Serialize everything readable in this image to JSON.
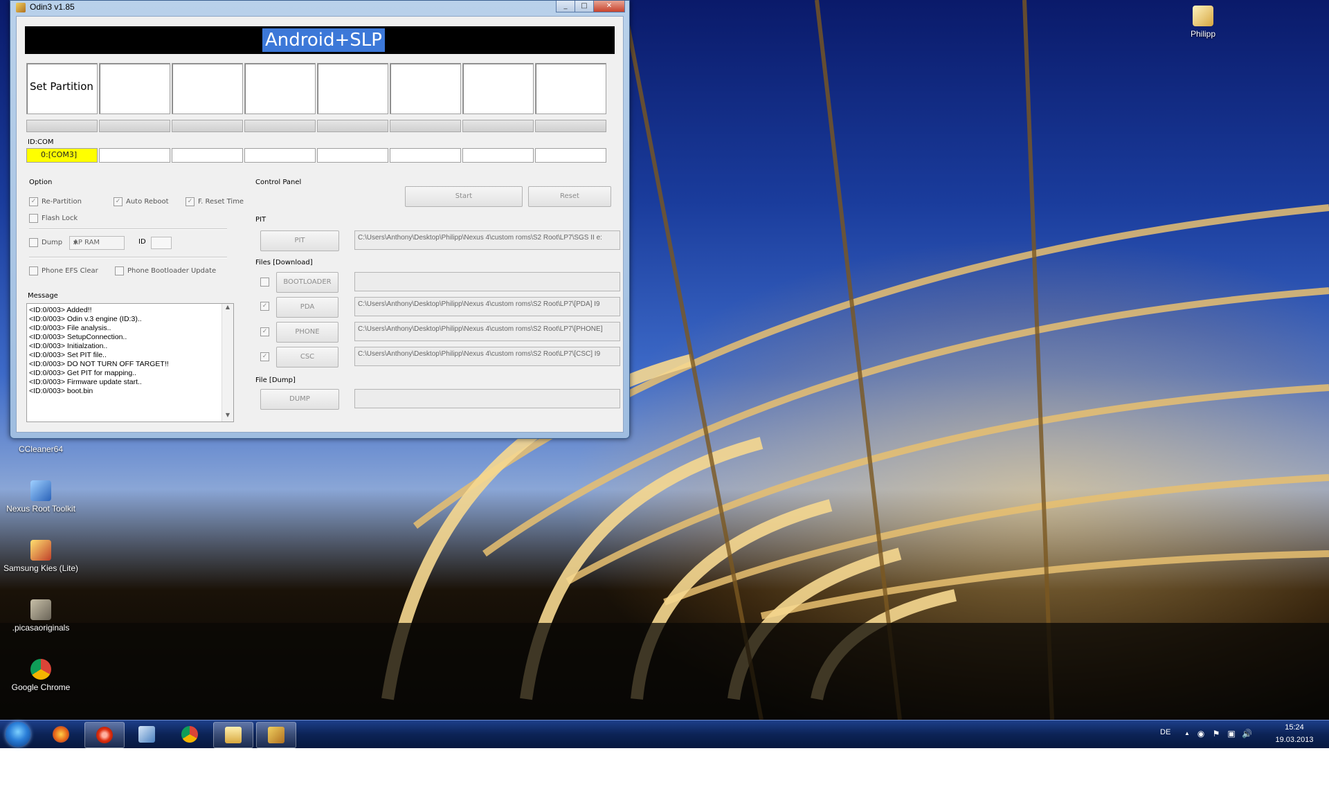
{
  "window": {
    "title": "Odin3 v1.85",
    "minimize_label": "_",
    "maximize_label": "□",
    "close_label": "✕"
  },
  "banner": {
    "text": "Android+SLP"
  },
  "ports": {
    "boxes": [
      "Set Partition",
      "",
      "",
      "",
      "",
      "",
      "",
      ""
    ],
    "idcom_label": "ID:COM",
    "com": [
      "0:[COM3]",
      "",
      "",
      "",
      "",
      "",
      "",
      ""
    ]
  },
  "option": {
    "label": "Option",
    "re_partition": "Re-Partition",
    "auto_reboot": "Auto Reboot",
    "f_reset_time": "F. Reset Time",
    "flash_lock": "Flash Lock",
    "dump": "Dump",
    "dump_select": "AP RAM",
    "id_label": "ID",
    "phone_efs_clear": "Phone EFS Clear",
    "phone_bootloader_update": "Phone Bootloader Update",
    "checked_mark": "✓"
  },
  "message": {
    "label": "Message",
    "lines": [
      "<ID:0/003> Added!!",
      "<ID:0/003> Odin v.3 engine (ID:3)..",
      "<ID:0/003> File analysis..",
      "<ID:0/003> SetupConnection..",
      "<ID:0/003> Initialzation..",
      "<ID:0/003> Set PIT file..",
      "<ID:0/003> DO NOT TURN OFF TARGET!!",
      "<ID:0/003> Get PIT for mapping..",
      "<ID:0/003> Firmware update start..",
      "<ID:0/003> boot.bin"
    ]
  },
  "control_panel": {
    "label": "Control Panel",
    "start": "Start",
    "reset": "Reset"
  },
  "pit": {
    "label": "PIT",
    "button": "PIT",
    "path": "C:\\Users\\Anthony\\Desktop\\Philipp\\Nexus 4\\custom roms\\S2 Root\\LP7\\SGS II e:"
  },
  "files": {
    "label": "Files [Download]",
    "bootloader": {
      "button": "BOOTLOADER",
      "path": ""
    },
    "pda": {
      "button": "PDA",
      "path": "C:\\Users\\Anthony\\Desktop\\Philipp\\Nexus 4\\custom roms\\S2 Root\\LP7\\[PDA] I9"
    },
    "phone": {
      "button": "PHONE",
      "path": "C:\\Users\\Anthony\\Desktop\\Philipp\\Nexus 4\\custom roms\\S2 Root\\LP7\\[PHONE]"
    },
    "csc": {
      "button": "CSC",
      "path": "C:\\Users\\Anthony\\Desktop\\Philipp\\Nexus 4\\custom roms\\S2 Root\\LP7\\[CSC] I9"
    }
  },
  "dump": {
    "label": "File [Dump]",
    "button": "DUMP",
    "path": ""
  },
  "desktop": {
    "icons": [
      "Philipp",
      "CCleaner64",
      "Nexus Root Toolkit",
      "Samsung Kies (Lite)",
      ".picasaoriginals",
      "Google Chrome"
    ]
  },
  "taskbar": {
    "language": "DE",
    "time": "15:24",
    "date": "19.03.2013",
    "tray_up": "▲"
  },
  "colors": {
    "banner_bg": "#000000",
    "banner_highlight": "#3c78d8",
    "com_active": "#ffff00"
  }
}
